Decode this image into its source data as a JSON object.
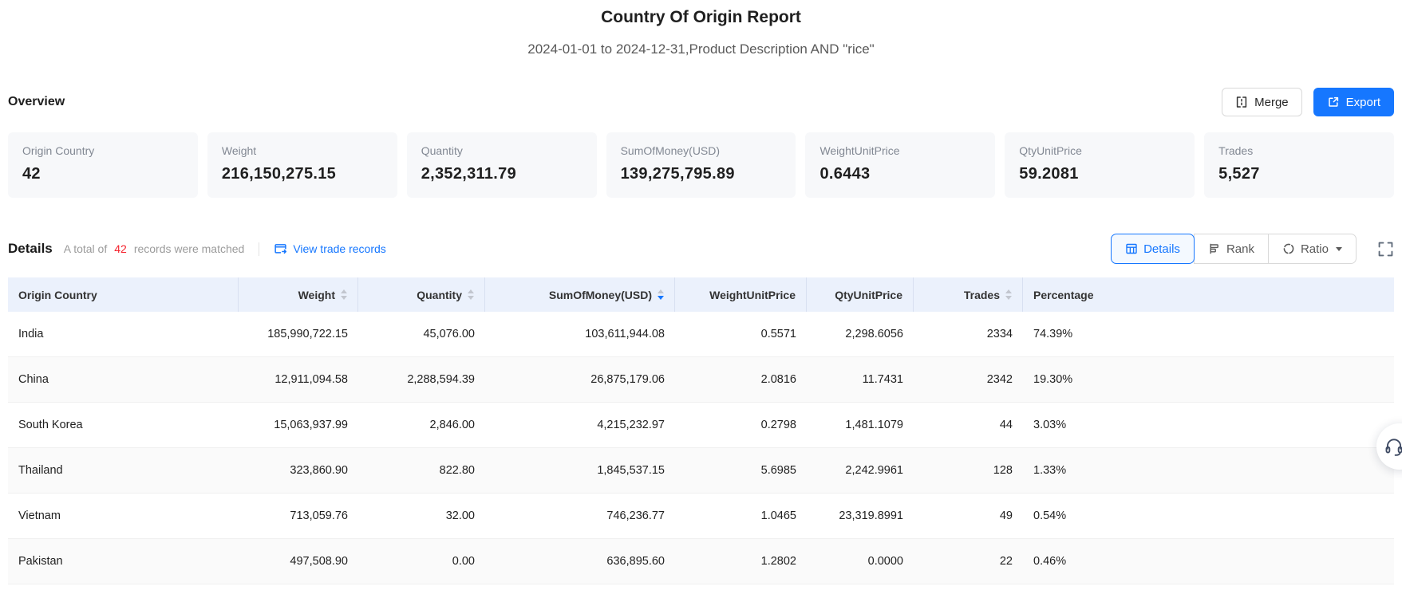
{
  "report": {
    "title": "Country Of Origin Report",
    "subtitle": "2024-01-01 to 2024-12-31,Product Description AND \"rice\""
  },
  "overview": {
    "heading": "Overview",
    "merge_label": "Merge",
    "export_label": "Export",
    "cards": [
      {
        "label": "Origin Country",
        "value": "42"
      },
      {
        "label": "Weight",
        "value": "216,150,275.15"
      },
      {
        "label": "Quantity",
        "value": "2,352,311.79"
      },
      {
        "label": "SumOfMoney(USD)",
        "value": "139,275,795.89"
      },
      {
        "label": "WeightUnitPrice",
        "value": "0.6443"
      },
      {
        "label": "QtyUnitPrice",
        "value": "59.2081"
      },
      {
        "label": "Trades",
        "value": "5,527"
      }
    ]
  },
  "details": {
    "heading": "Details",
    "matched_prefix": "A total of",
    "matched_count": "42",
    "matched_suffix": "records were matched",
    "view_link": "View trade records",
    "tabs": [
      {
        "label": "Details",
        "active": true
      },
      {
        "label": "Rank",
        "active": false
      },
      {
        "label": "Ratio",
        "active": false,
        "dropdown": true
      }
    ]
  },
  "table": {
    "columns": [
      {
        "label": "Origin Country",
        "align": "left",
        "sortable": false,
        "sort": null
      },
      {
        "label": "Weight",
        "align": "right",
        "sortable": true,
        "sort": null
      },
      {
        "label": "Quantity",
        "align": "right",
        "sortable": true,
        "sort": null
      },
      {
        "label": "SumOfMoney(USD)",
        "align": "right",
        "sortable": true,
        "sort": "desc"
      },
      {
        "label": "WeightUnitPrice",
        "align": "right",
        "sortable": false,
        "sort": null
      },
      {
        "label": "QtyUnitPrice",
        "align": "right",
        "sortable": false,
        "sort": null
      },
      {
        "label": "Trades",
        "align": "right",
        "sortable": true,
        "sort": null
      },
      {
        "label": "Percentage",
        "align": "left",
        "sortable": false,
        "sort": null
      }
    ],
    "rows": [
      [
        "India",
        "185,990,722.15",
        "45,076.00",
        "103,611,944.08",
        "0.5571",
        "2,298.6056",
        "2334",
        "74.39%"
      ],
      [
        "China",
        "12,911,094.58",
        "2,288,594.39",
        "26,875,179.06",
        "2.0816",
        "11.7431",
        "2342",
        "19.30%"
      ],
      [
        "South Korea",
        "15,063,937.99",
        "2,846.00",
        "4,215,232.97",
        "0.2798",
        "1,481.1079",
        "44",
        "3.03%"
      ],
      [
        "Thailand",
        "323,860.90",
        "822.80",
        "1,845,537.15",
        "5.6985",
        "2,242.9961",
        "128",
        "1.33%"
      ],
      [
        "Vietnam",
        "713,059.76",
        "32.00",
        "746,236.77",
        "1.0465",
        "23,319.8991",
        "49",
        "0.54%"
      ],
      [
        "Pakistan",
        "497,508.90",
        "0.00",
        "636,895.60",
        "1.2802",
        "0.0000",
        "22",
        "0.46%"
      ]
    ]
  },
  "colors": {
    "accent": "#1677ff",
    "danger": "#f5222d",
    "table_header_bg": "#ebf1fc",
    "card_bg": "#f7f8fa"
  }
}
